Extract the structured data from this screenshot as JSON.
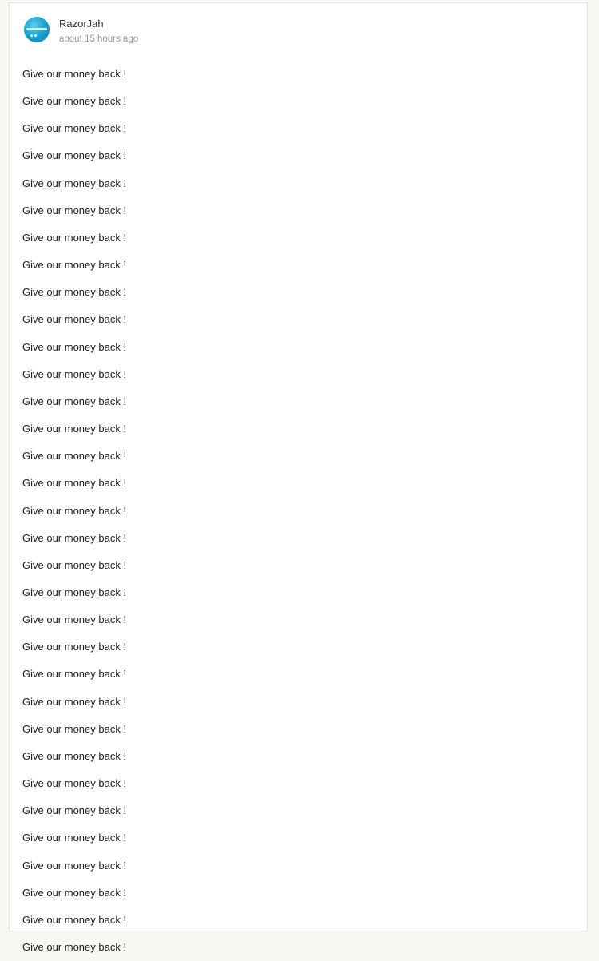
{
  "post": {
    "author": "RazorJah",
    "timestamp": "about 15 hours ago",
    "avatar_icon": "user-avatar-icon",
    "accent_color": "#1ea3cf",
    "lines": [
      "Give our money back !",
      "Give our money back !",
      "Give our money back !",
      "Give our money back !",
      "Give our money back !",
      "Give our money back !",
      "Give our money back !",
      "Give our money back !",
      "Give our money back !",
      "Give our money back !",
      "Give our money back !",
      "Give our money back !",
      "Give our money back !",
      "Give our money back !",
      "Give our money back !",
      "Give our money back !",
      "Give our money back !",
      "Give our money back !",
      "Give our money back !",
      "Give our money back !",
      "Give our money back !",
      "Give our money back !",
      "Give our money back !",
      "Give our money back !",
      "Give our money back !",
      "Give our money back !",
      "Give our money back !",
      "Give our money back !",
      "Give our money back !",
      "Give our money back !",
      "Give our money back !",
      "Give our money back !",
      "Give our money back !"
    ]
  }
}
